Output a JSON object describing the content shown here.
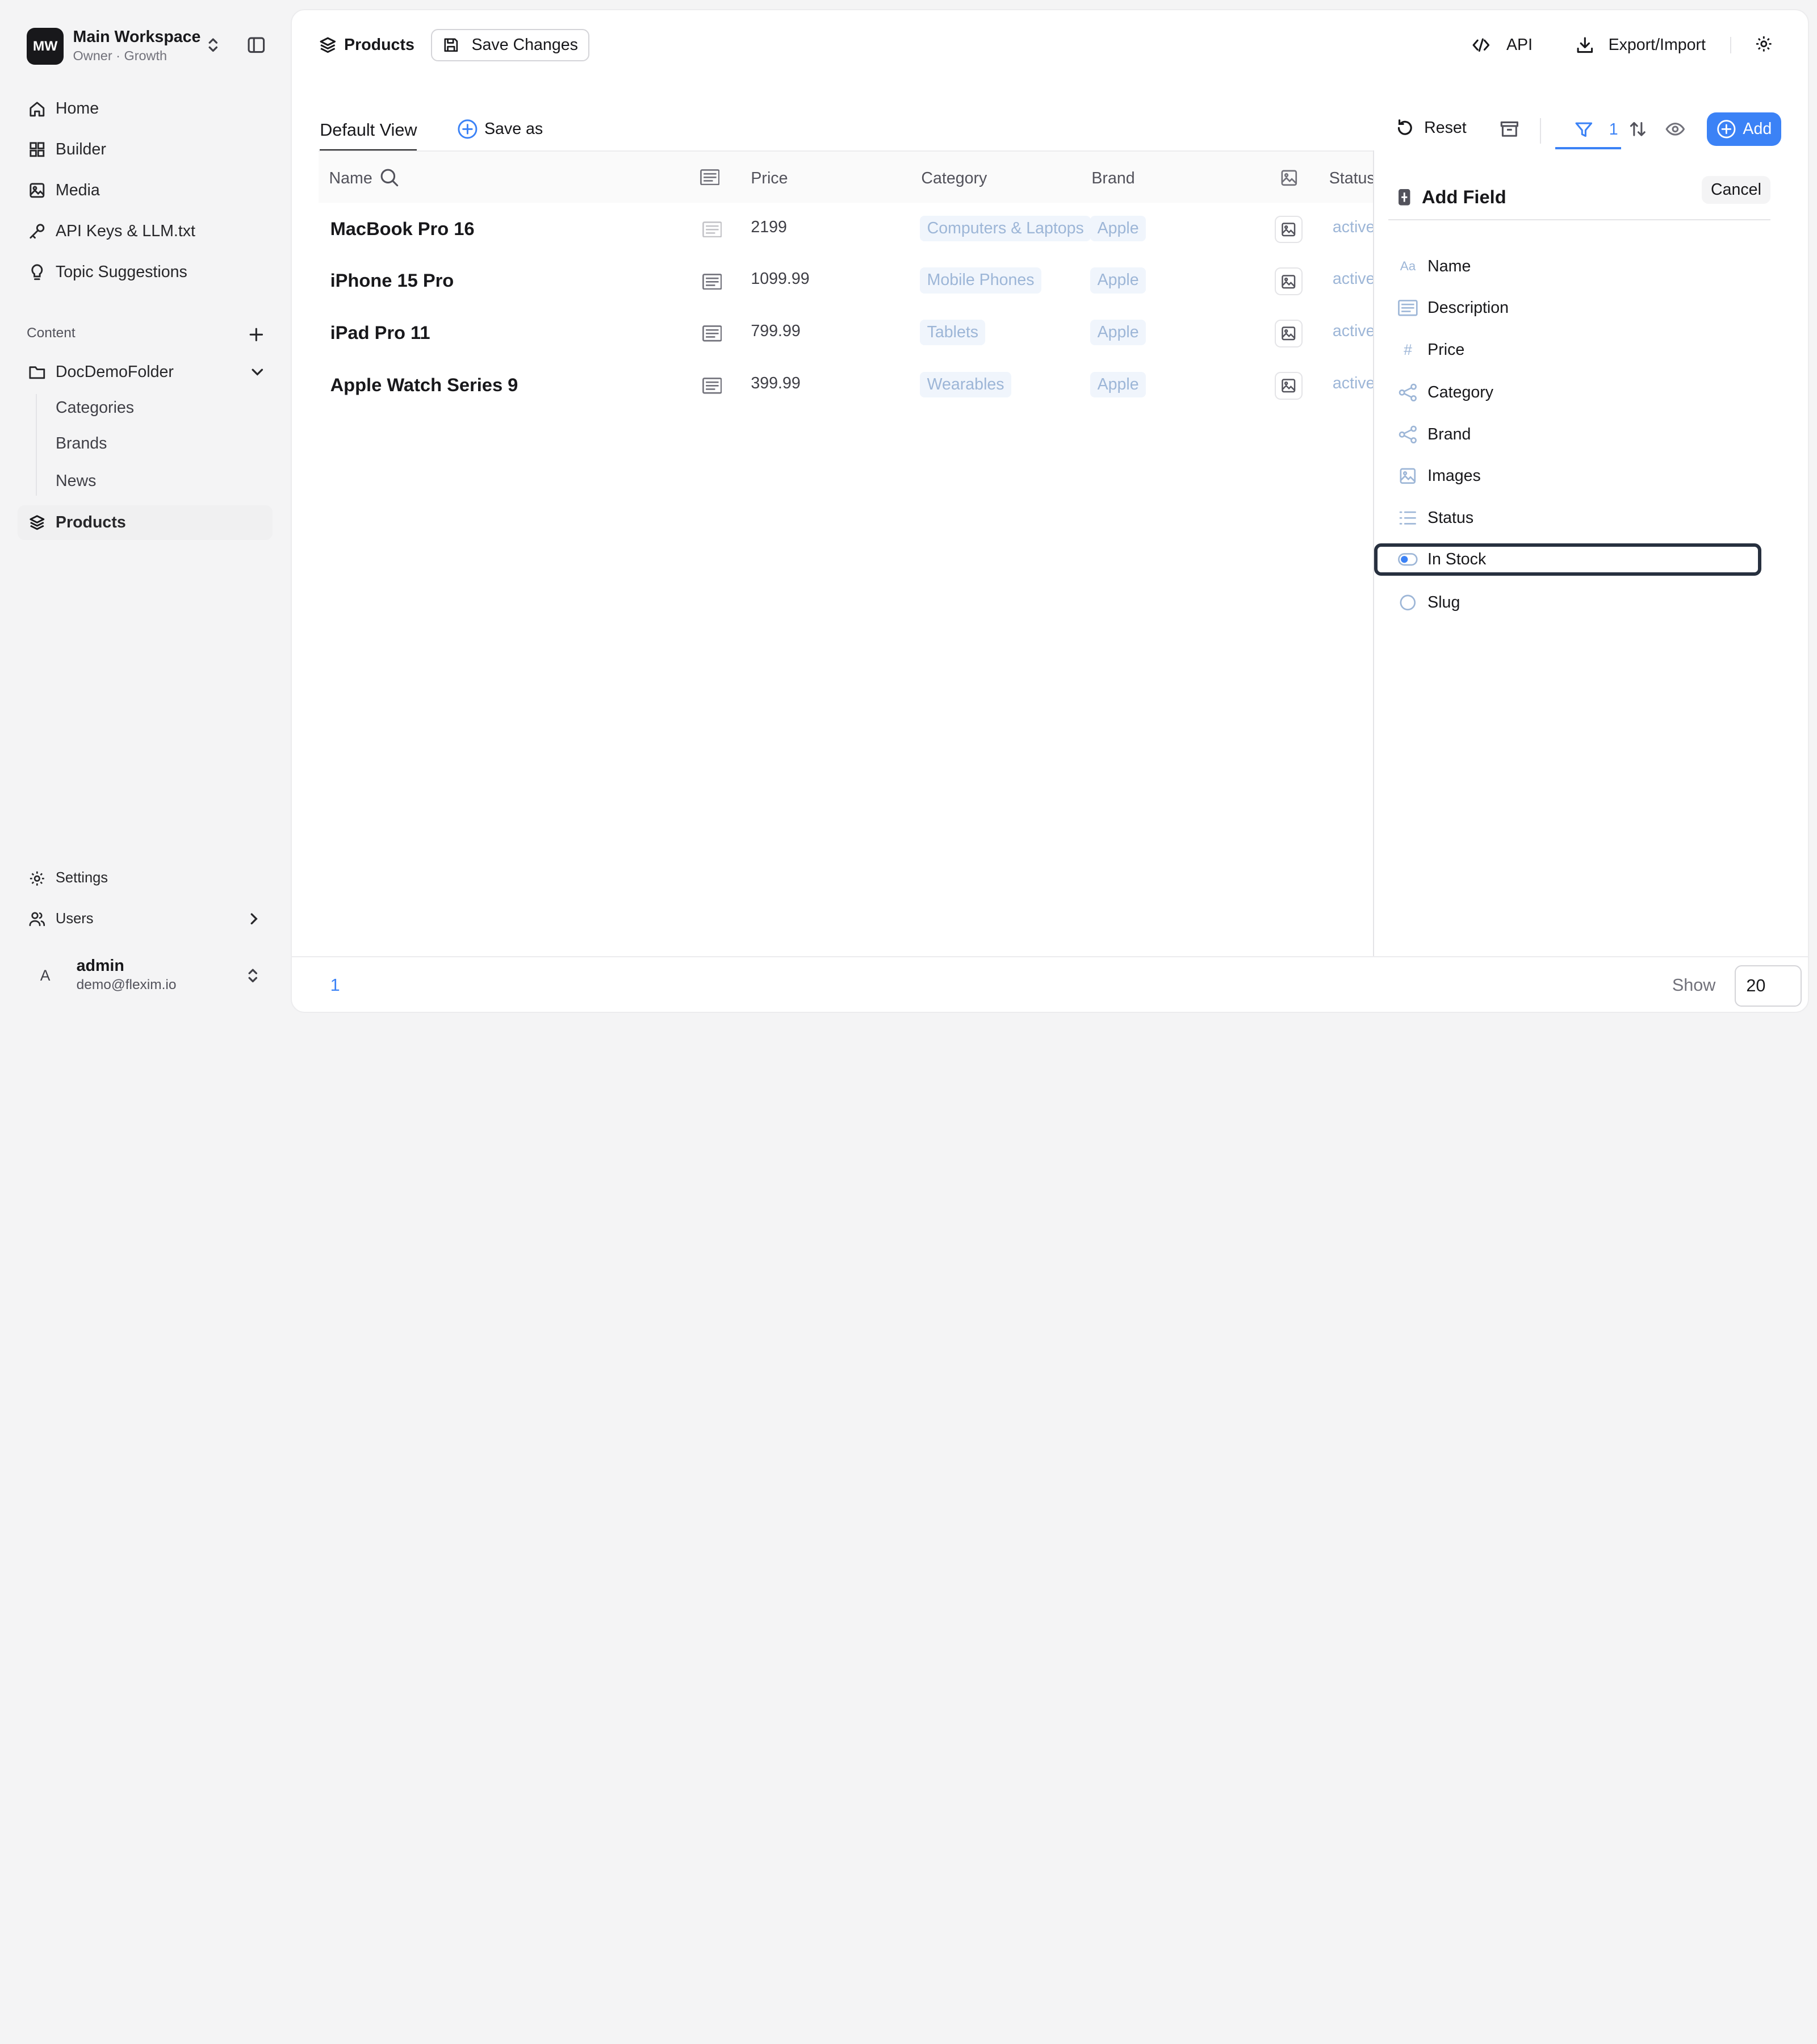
{
  "workspace": {
    "initials": "MW",
    "name": "Main Workspace",
    "subtitle": "Owner · Growth"
  },
  "nav": [
    {
      "label": "Home",
      "icon": "home-icon"
    },
    {
      "label": "Builder",
      "icon": "grid-icon"
    },
    {
      "label": "Media",
      "icon": "image-icon"
    },
    {
      "label": "API Keys & LLM.txt",
      "icon": "key-icon"
    },
    {
      "label": "Topic Suggestions",
      "icon": "lightbulb-icon"
    }
  ],
  "content": {
    "section_label": "Content",
    "folder": "DocDemoFolder",
    "sub_items": [
      "Categories",
      "Brands",
      "News"
    ],
    "products": "Products"
  },
  "bottom_nav": {
    "settings": "Settings",
    "users": "Users"
  },
  "user": {
    "initial": "A",
    "name": "admin",
    "email": "demo@flexim.io"
  },
  "topbar": {
    "breadcrumb": "Products",
    "save_changes": "Save Changes",
    "api": "API",
    "export_import": "Export/Import"
  },
  "viewbar": {
    "view_tab": "Default View",
    "save_as": "Save as",
    "reset": "Reset",
    "filter_count": "1",
    "add": "Add"
  },
  "table": {
    "headers": {
      "name": "Name",
      "price": "Price",
      "category": "Category",
      "brand": "Brand",
      "status": "Status"
    },
    "rows": [
      {
        "name": "MacBook Pro 16",
        "price": "2199",
        "category": "Computers & Laptops",
        "brand": "Apple",
        "status": "active"
      },
      {
        "name": "iPhone 15 Pro",
        "price": "1099.99",
        "category": "Mobile Phones",
        "brand": "Apple",
        "status": "active"
      },
      {
        "name": "iPad Pro 11",
        "price": "799.99",
        "category": "Tablets",
        "brand": "Apple",
        "status": "active"
      },
      {
        "name": "Apple Watch Series 9",
        "price": "399.99",
        "category": "Wearables",
        "brand": "Apple",
        "status": "active"
      }
    ]
  },
  "add_field": {
    "title": "Add Field",
    "cancel": "Cancel",
    "fields": [
      {
        "label": "Name",
        "icon": "text-aa-icon",
        "glyph": "Aa"
      },
      {
        "label": "Description",
        "icon": "paragraph-icon"
      },
      {
        "label": "Price",
        "icon": "hash-icon",
        "glyph": "#"
      },
      {
        "label": "Category",
        "icon": "relation-icon"
      },
      {
        "label": "Brand",
        "icon": "relation-icon"
      },
      {
        "label": "Images",
        "icon": "image-icon"
      },
      {
        "label": "Status",
        "icon": "list-icon"
      },
      {
        "label": "In Stock",
        "icon": "toggle-icon"
      },
      {
        "label": "Slug",
        "icon": "circle-icon"
      }
    ]
  },
  "footer": {
    "page": "1",
    "show_label": "Show",
    "page_size": "20"
  },
  "colors": {
    "accent": "#3b82f6",
    "tag_bg": "#f0f5fc",
    "tag_text": "#9db6d7",
    "focus_border": "#27303f"
  }
}
